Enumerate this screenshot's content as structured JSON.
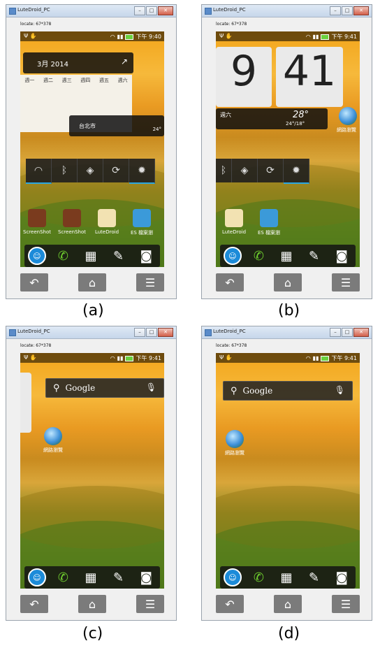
{
  "panels": [
    {
      "caption": "(a)",
      "window_title": "LuteDroid_PC",
      "locate": "locate: 67*378",
      "time": "下午 9:40",
      "calendar_header": "3月 2014",
      "weekdays": [
        "週一",
        "週二",
        "週三",
        "週四",
        "週五",
        "週六"
      ],
      "weather_place": "台北市",
      "temp": "24°",
      "apps": [
        "ScreenShot",
        "ScreenShot",
        "LuteDroid",
        "ES 檔案瀏"
      ]
    },
    {
      "caption": "(b)",
      "window_title": "LuteDroid_PC",
      "locate": "locate: 67*378",
      "time": "下午 9:41",
      "clock_hour": "9",
      "clock_min": "41",
      "weekday": "週六",
      "temp_big": "28°",
      "temp_range": "24°/18°",
      "apps": [
        "LuteDroid",
        "ES 檔案瀏"
      ],
      "globe_label": "網路瀏覽"
    },
    {
      "caption": "(c)",
      "window_title": "LuteDroid_PC",
      "locate": "locate: 67*378",
      "time": "下午 9:41",
      "search": "Google",
      "globe_label": "網路瀏覽"
    },
    {
      "caption": "(d)",
      "window_title": "LuteDroid_PC",
      "locate": "locate: 67*378",
      "time": "下午 9:41",
      "search": "Google",
      "globe_label": "網路瀏覽"
    }
  ],
  "colors": {
    "nav_button": "#7b7b7b",
    "statusbar_battery": "#6ad13e",
    "qs_accent": "#2aa7e0"
  },
  "icons": {
    "back": "back-icon",
    "home": "home-icon",
    "menu": "menu-icon"
  }
}
